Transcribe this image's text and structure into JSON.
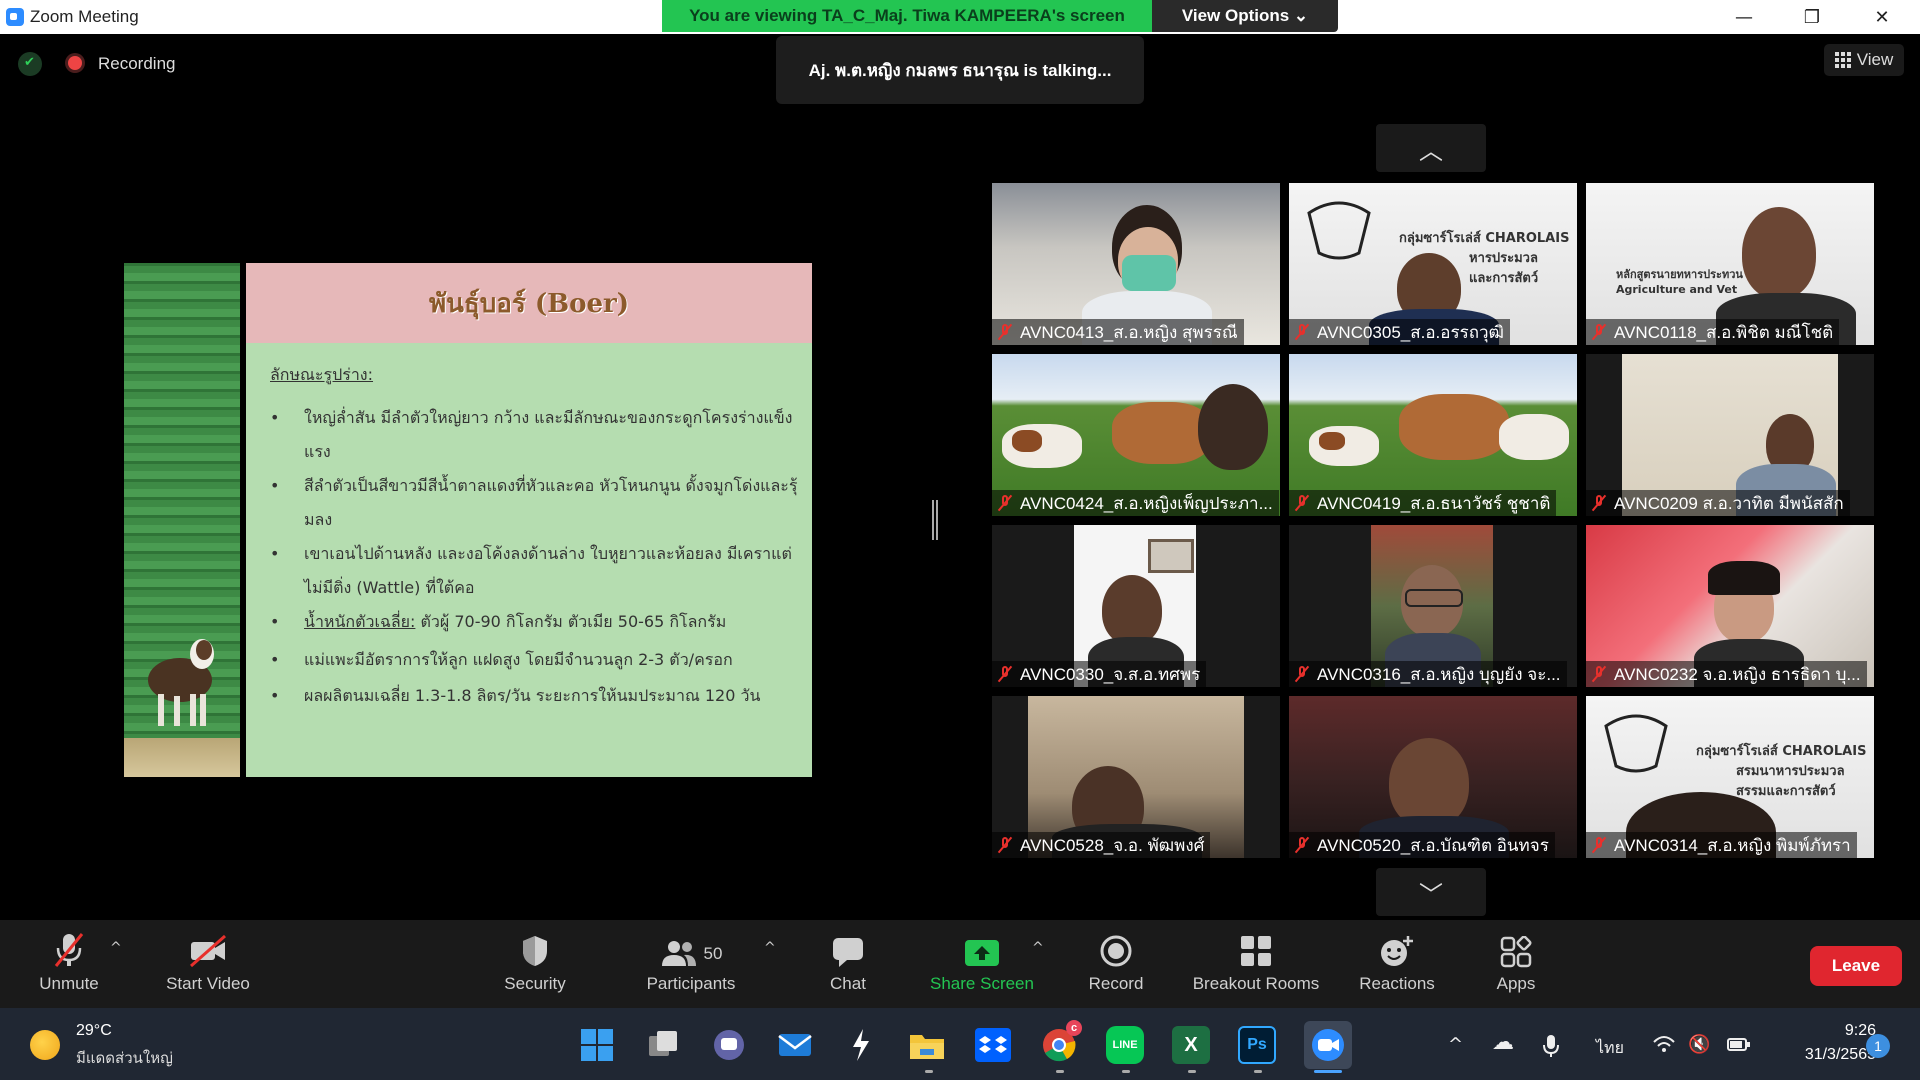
{
  "window": {
    "title": "Zoom Meeting",
    "minimize_icon": "—",
    "maximize_icon": "❐",
    "close_icon": "✕"
  },
  "share_banner": {
    "text": "You are viewing TA_C_Maj. Tiwa KAMPEERA's screen",
    "view_options_label": "View Options ⌄",
    "color": "#23c552"
  },
  "top_overlay": {
    "recording_label": "Recording",
    "talking_text": "Aj. พ.ต.หญิง กมลพร ธนารุณ is  talking...",
    "view_label": "View"
  },
  "slide": {
    "title": "พันธุ์บอร์ (Boer)",
    "subtitle": "ลักษณะรูปร่าง:",
    "bullet_glyph": "•",
    "bullets": [
      {
        "text": "ใหญ่ล่ำสัน มีลำตัวใหญ่ยาว กว้าง และมีลักษณะของกระดูกโครงร่างแข็งแรง"
      },
      {
        "text": "สีลำตัวเป็นสีขาวมีสีน้ำตาลแดงที่หัวและคอ หัวโหนกนูน ดั้งจมูกโด่งและรุ้มลง"
      },
      {
        "text": "เขาเอนไปด้านหลัง และงอโค้งลงด้านล่าง ใบหูยาวและห้อยลง มีเคราแต่ไม่มีติ่ง (Wattle) ที่ใต้คอ"
      },
      {
        "prefix": "น้ำหนักตัวเฉลี่ย:",
        "text": " ตัวผู้ 70-90 กิโลกรัม ตัวเมีย 50-65 กิโลกรัม"
      },
      {
        "text": "แม่แพะมีอัตราการให้ลูก แฝดสูง โดยมีจำนวนลูก 2-3 ตัว/ครอก"
      },
      {
        "text": "ผลผลิตนมเฉลี่ย 1.3-1.8 ลิตร/วัน ระยะการให้นมประมาณ 120 วัน"
      }
    ]
  },
  "gallery": {
    "up_arrow": "︿",
    "down_arrow": "﹀",
    "participants": [
      {
        "name": "AVNC0413_ส.อ.หญิง สุพรรณี"
      },
      {
        "name": "AVNC0305_ส.อ.อรรถวุฒิ"
      },
      {
        "name": "AVNC0118_ส.อ.พิชิต มณีโชติ"
      },
      {
        "name": "AVNC0424_ส.อ.หญิงเพ็ญประภา..."
      },
      {
        "name": "AVNC0419_ส.อ.ธนาวัชร์ ชูชาติ"
      },
      {
        "name": "AVNC0209 ส.อ.วาทิต มีพนัสสัก"
      },
      {
        "name": "AVNC0330_จ.ส.อ.ทศพร"
      },
      {
        "name": "AVNC0316_ส.อ.หญิง บุญยัง  จะ..."
      },
      {
        "name": "AVNC0232 จ.อ.หญิง ธารธิดา บุ..."
      },
      {
        "name": "AVNC0528_จ.อ. พัฒพงศ์"
      },
      {
        "name": "AVNC0520_ส.อ.บัณฑิต อินทจร"
      },
      {
        "name": "AVNC0314_ส.อ.หญิง พิมพ์ภัทรา"
      }
    ],
    "logo_line1": "กลุ่มซาร์โรเล่ส์ CHAROLAIS",
    "logo_line2": "หารประมวล",
    "logo_line3": "และการสัตว์",
    "logo_line_b1": "กลุ่มซาร์โรเล่ส์ CHAROLAIS",
    "logo_line_b2": "สรมนาหารประมวล",
    "logo_line_b3": "สรรมและการสัตว์",
    "logo_line_c1": "หลักสูตรนายทหารประทวน",
    "logo_line_c2": "Agriculture and Vet"
  },
  "toolbar": {
    "unmute": "Unmute",
    "start_video": "Start Video",
    "security": "Security",
    "participants": "Participants",
    "participants_count": "50",
    "chat": "Chat",
    "share_screen": "Share Screen",
    "record": "Record",
    "breakout_rooms": "Breakout Rooms",
    "reactions": "Reactions",
    "apps": "Apps",
    "leave": "Leave",
    "caret": "^",
    "share_color": "#23c552",
    "leave_color": "#e0262f"
  },
  "taskbar": {
    "weather_temp": "29°C",
    "weather_desc": "มีแดดส่วนใหญ่",
    "chrome_badge": "c",
    "line_label": "LINE",
    "excel_label": "X",
    "ps_label": "Ps",
    "tray_chevron": "^",
    "tray_cloud": "☁",
    "tray_speaker": "🔇",
    "language": "ไทย",
    "time": "9:26",
    "date": "31/3/2565",
    "notifications": "1"
  }
}
